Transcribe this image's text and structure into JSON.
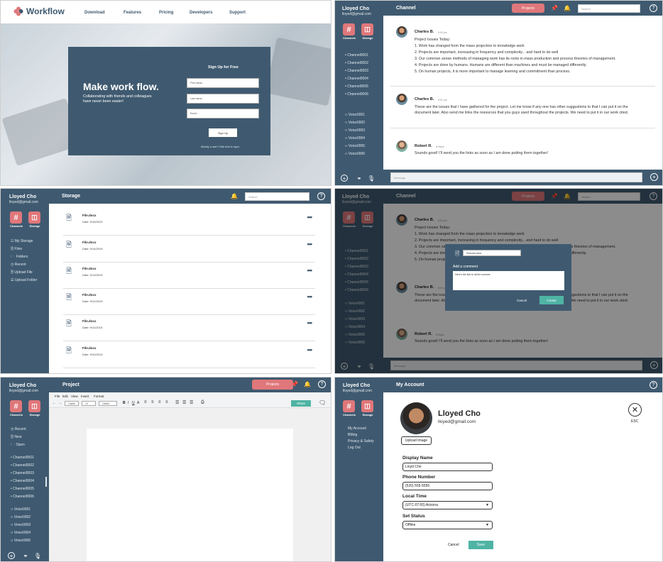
{
  "colors": {
    "primary": "#3f5a70",
    "accent": "#e0777a",
    "teal": "#4fb4a4"
  },
  "user": {
    "name": "Lloyed Cho",
    "email": "lloyed@gmail.com"
  },
  "tiles": {
    "channels": "Channels",
    "storage": "Storage"
  },
  "landing": {
    "brand": "Workflow",
    "nav": [
      "Download",
      "Features",
      "Pricing",
      "Developers",
      "Support"
    ],
    "headline": "Make work flow.",
    "subline1": "Collaborating with friends and colleagues",
    "subline2": "have never been easier!",
    "signup_title": "Sign Up for Free",
    "first_name_ph": "First name...",
    "last_name_ph": "Last name...",
    "email_ph": "Email...",
    "signup_btn": "Sign Up",
    "login_note": "Already a user? Click here to log in"
  },
  "channels": [
    "Channel0001",
    "Channel0002",
    "Channel0003",
    "Channel0004",
    "Channel0005",
    "Channel0006"
  ],
  "voices": [
    "Voice0001",
    "Voice0002",
    "Voice0003",
    "Voice0004",
    "Voice0005",
    "Voice0006"
  ],
  "voices_short": [
    "Voice0001",
    "Voice0002",
    "Voice0003",
    "Voice0004",
    "Voice0005"
  ],
  "chat": {
    "title": "Channel",
    "projects_btn": "Projects",
    "search_ph": "Search",
    "message_ph": "Message",
    "messages": [
      {
        "name": "Charles B.",
        "time": "5:00 pm",
        "lines": [
          "Project Issues Today:",
          "1. Work has changed from the mass projection to knowledge work",
          "2. Projects are important, increasing in frequency and complexity... and hard to do well",
          "3. Our common sense methods of managing work has its roots in mass production and process theories of management.",
          "4. Projects are done by humans. Humans are different than machines and must be managed differently.",
          "5. On human projects, it is more important to manage learning and commitment than process."
        ]
      },
      {
        "name": "Charles B.",
        "time": "5:01 pm",
        "lines": [
          "These are the issues that I have gathered for the project. Let me know if any one has other suggustions to that I can put it on the",
          "document later. Also send me links the resources that you guys used throughout the projects. We need to put it in our work cited."
        ]
      },
      {
        "name": "Robert R.",
        "time": "5:05pm",
        "lines": [
          "Sounds good! I'll send you the links as soon as I am done putting them together!"
        ]
      }
    ]
  },
  "storage": {
    "title": "Storage",
    "search_ph": "Search",
    "menu": [
      "My Storage",
      "Files",
      "Folders",
      "Recent",
      "Upload File",
      "Upload Folder"
    ],
    "files": [
      {
        "name": "File.docx",
        "date": "Date: 9/15/2019"
      },
      {
        "name": "File.docx",
        "date": "Date: 9/14/2019"
      },
      {
        "name": "File.docx",
        "date": "Date: 9/13/2019"
      },
      {
        "name": "File.docx",
        "date": "Date: 9/12/2019"
      },
      {
        "name": "File.docx",
        "date": "Date: 9/11/2019"
      },
      {
        "name": "File.docx",
        "date": "Date: 9/10/2019"
      }
    ]
  },
  "modal": {
    "file": "Sources.docx",
    "label": "Add a comment",
    "comment": "Here's the link to all the sources",
    "cancel": "Cancel",
    "create": "Create"
  },
  "project": {
    "title": "Project",
    "projects_btn": "Projects",
    "menu": [
      "File",
      "Edit",
      "View",
      "Insert",
      "Format"
    ],
    "font": "Calibri",
    "size": "12",
    "font2": "Calibri",
    "share": "Share",
    "side_menu": [
      "Recent",
      "New",
      "Open"
    ]
  },
  "account": {
    "title": "My Account",
    "name": "Lloyed Cho",
    "email": "lloyed@gmail.com",
    "upload": "Upload Image",
    "esc": "ESC",
    "menu": [
      "My Account",
      "Billing",
      "Privacy & Safety",
      "Log Out"
    ],
    "display_label": "Display Name",
    "display_value": "Lloyd Cho",
    "phone_label": "Phone Number",
    "phone_value": "(520) 555-5555",
    "time_label": "Local Time",
    "time_value": "(UTC-07:00) Arizona",
    "status_label": "Set Status",
    "status_value": "Offline",
    "cancel": "Cancel",
    "save": "Save"
  }
}
